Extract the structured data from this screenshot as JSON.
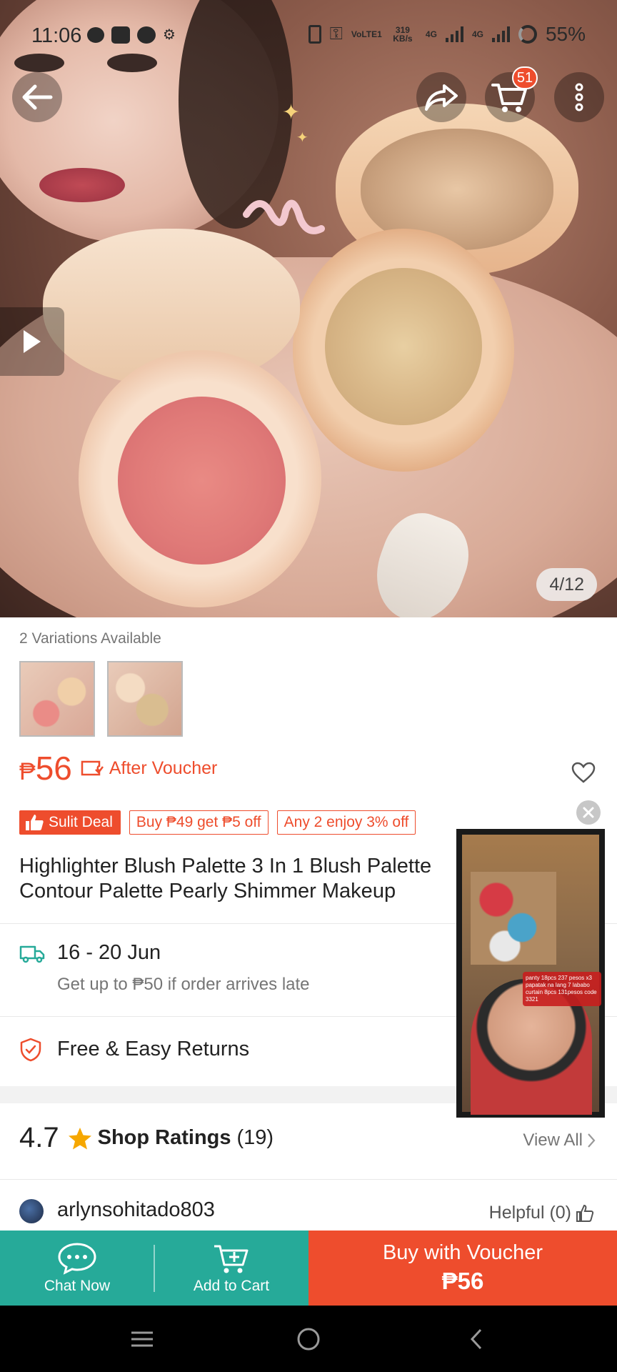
{
  "status_bar": {
    "time": "11:06",
    "volte": "VoLTE1",
    "speed": "319 KB/s",
    "net1": "4G",
    "net2": "4G",
    "battery": "55%"
  },
  "hero": {
    "cart_count": "51",
    "image_counter": "4/12"
  },
  "product": {
    "variations_label": "2 Variations Available",
    "price_currency": "₱",
    "price_value": "56",
    "after_voucher": "After Voucher",
    "tags": [
      "Sulit Deal",
      "Buy ₱49 get ₱5 off",
      "Any 2 enjoy 3% off"
    ],
    "title": "Highlighter Blush Palette 3 In 1 Blush Palette Contour Palette Pearly Shimmer Makeup"
  },
  "shipping": {
    "date": "16 - 20 Jun",
    "late_note": "Get up to ₱50 if order arrives late"
  },
  "returns": {
    "label": "Free & Easy Returns"
  },
  "ratings": {
    "value": "4.7",
    "label": "Shop Ratings",
    "count": "(19)",
    "view_all": "View All"
  },
  "review": {
    "username": "arlynsohitado803",
    "helpful": "Helpful (0)"
  },
  "live": {
    "caption": "panty 18pcs 237 pesos x3 papatak na lang 7 lababo curtain 8pcs 131pesos code 3321"
  },
  "bottom_bar": {
    "chat": "Chat Now",
    "add_to_cart": "Add to Cart",
    "buy_label": "Buy with Voucher",
    "buy_price": "₱56"
  },
  "colors": {
    "brand": "#ee4d2d",
    "teal": "#26aa99"
  }
}
